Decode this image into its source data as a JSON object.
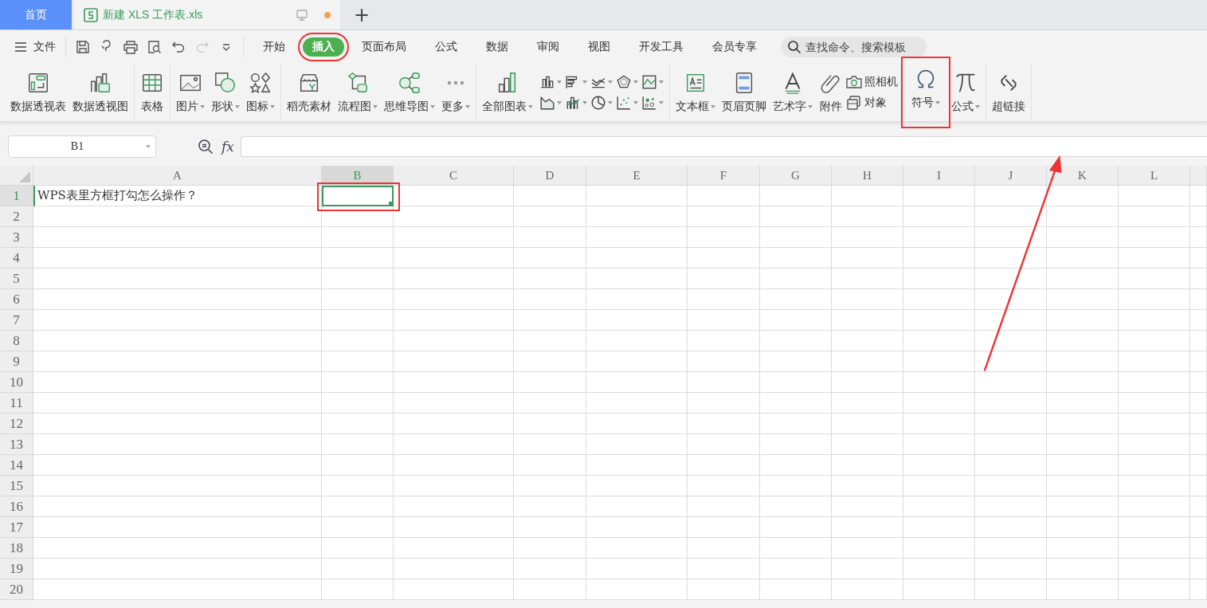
{
  "doc_tabs": [
    {
      "label": "首页",
      "kind": "home",
      "selected": false
    },
    {
      "label": "新建 XLS 工作表.xls",
      "kind": "file",
      "selected": true,
      "modified": true
    }
  ],
  "new_tab": "+",
  "file_menu": "文件",
  "menu_tabs": [
    {
      "label": "开始",
      "selected": false,
      "highlighted": false
    },
    {
      "label": "插入",
      "selected": true,
      "highlighted": true
    },
    {
      "label": "页面布局",
      "selected": false,
      "highlighted": false
    },
    {
      "label": "公式",
      "selected": false,
      "highlighted": false
    },
    {
      "label": "数据",
      "selected": false,
      "highlighted": false
    },
    {
      "label": "审阅",
      "selected": false,
      "highlighted": false
    },
    {
      "label": "视图",
      "selected": false,
      "highlighted": false
    },
    {
      "label": "开发工具",
      "selected": false,
      "highlighted": false
    },
    {
      "label": "会员专享",
      "selected": false,
      "highlighted": false
    }
  ],
  "search": {
    "placeholder": "查找命令、搜索模板"
  },
  "ribbon": [
    {
      "items": [
        {
          "kind": "big",
          "label": "数据透视表",
          "dropdown": false,
          "highlighted": false
        },
        {
          "kind": "big",
          "label": "数据透视图",
          "dropdown": false,
          "highlighted": false
        }
      ]
    },
    {
      "items": [
        {
          "kind": "big",
          "label": "表格",
          "dropdown": false,
          "highlighted": false
        }
      ]
    },
    {
      "items": [
        {
          "kind": "big",
          "label": "图片",
          "dropdown": true,
          "highlighted": false
        },
        {
          "kind": "big",
          "label": "形状",
          "dropdown": true,
          "highlighted": false
        },
        {
          "kind": "big",
          "label": "图标",
          "dropdown": true,
          "highlighted": false
        }
      ]
    },
    {
      "items": [
        {
          "kind": "big",
          "label": "稻壳素材",
          "dropdown": false,
          "highlighted": false
        },
        {
          "kind": "big",
          "label": "流程图",
          "dropdown": true,
          "highlighted": false
        },
        {
          "kind": "big",
          "label": "思维导图",
          "dropdown": true,
          "highlighted": false
        },
        {
          "kind": "big",
          "label": "更多",
          "dropdown": true,
          "highlighted": false
        }
      ]
    },
    {
      "items": [
        {
          "kind": "big",
          "label": "全部图表",
          "dropdown": true,
          "highlighted": false
        },
        {
          "kind": "chart_grid",
          "charts": [
            {
              "dropdown": true
            },
            {
              "dropdown": true
            },
            {
              "dropdown": true
            },
            {
              "dropdown": true
            },
            {
              "dropdown": true
            },
            {
              "dropdown": true
            },
            {
              "dropdown": true
            },
            {
              "dropdown": true
            },
            {
              "dropdown": true
            },
            {
              "dropdown": true
            }
          ]
        }
      ]
    },
    {
      "items": [
        {
          "kind": "big",
          "label": "文本框",
          "dropdown": true,
          "highlighted": false
        },
        {
          "kind": "big",
          "label": "页眉页脚",
          "dropdown": false,
          "highlighted": false
        },
        {
          "kind": "big",
          "label": "艺术字",
          "dropdown": true,
          "highlighted": false
        },
        {
          "kind": "big",
          "label": "附件",
          "dropdown": false,
          "highlighted": false
        },
        {
          "kind": "stack",
          "entries": [
            "照相机",
            "对象"
          ]
        }
      ]
    },
    {
      "items": [
        {
          "kind": "big",
          "label": "符号",
          "dropdown": true,
          "highlighted": true
        },
        {
          "kind": "big",
          "label": "公式",
          "dropdown": true,
          "highlighted": false
        }
      ]
    },
    {
      "items": [
        {
          "kind": "big",
          "label": "超链接",
          "dropdown": false,
          "highlighted": false
        }
      ]
    }
  ],
  "formula_bar": {
    "name_box": "B1",
    "fx": "fx"
  },
  "sheet": {
    "columns": [
      {
        "label": "A",
        "selected": false
      },
      {
        "label": "B",
        "selected": true
      },
      {
        "label": "C",
        "selected": false
      },
      {
        "label": "D",
        "selected": false
      },
      {
        "label": "E",
        "selected": false
      },
      {
        "label": "F",
        "selected": false
      },
      {
        "label": "G",
        "selected": false
      },
      {
        "label": "H",
        "selected": false
      },
      {
        "label": "I",
        "selected": false
      },
      {
        "label": "J",
        "selected": false
      },
      {
        "label": "K",
        "selected": false
      },
      {
        "label": "L",
        "selected": false
      }
    ],
    "rows": [
      {
        "label": "1",
        "selected": true,
        "cells": [
          {
            "text": "WPS表里方框打勾怎么操作？",
            "active": false,
            "highlighted": false
          },
          {
            "active": true,
            "highlighted": true
          }
        ]
      },
      {
        "label": "2",
        "selected": false
      },
      {
        "label": "3",
        "selected": false
      },
      {
        "label": "4",
        "selected": false
      },
      {
        "label": "5",
        "selected": false
      },
      {
        "label": "6",
        "selected": false
      },
      {
        "label": "7",
        "selected": false
      },
      {
        "label": "8",
        "selected": false
      },
      {
        "label": "9",
        "selected": false
      },
      {
        "label": "10",
        "selected": false
      },
      {
        "label": "11",
        "selected": false
      },
      {
        "label": "12",
        "selected": false
      },
      {
        "label": "13",
        "selected": false
      },
      {
        "label": "14",
        "selected": false
      },
      {
        "label": "15",
        "selected": false
      },
      {
        "label": "16",
        "selected": false
      },
      {
        "label": "17",
        "selected": false
      },
      {
        "label": "18",
        "selected": false
      },
      {
        "label": "19",
        "selected": false
      },
      {
        "label": "20",
        "selected": false
      }
    ]
  },
  "callout_arrow": true
}
